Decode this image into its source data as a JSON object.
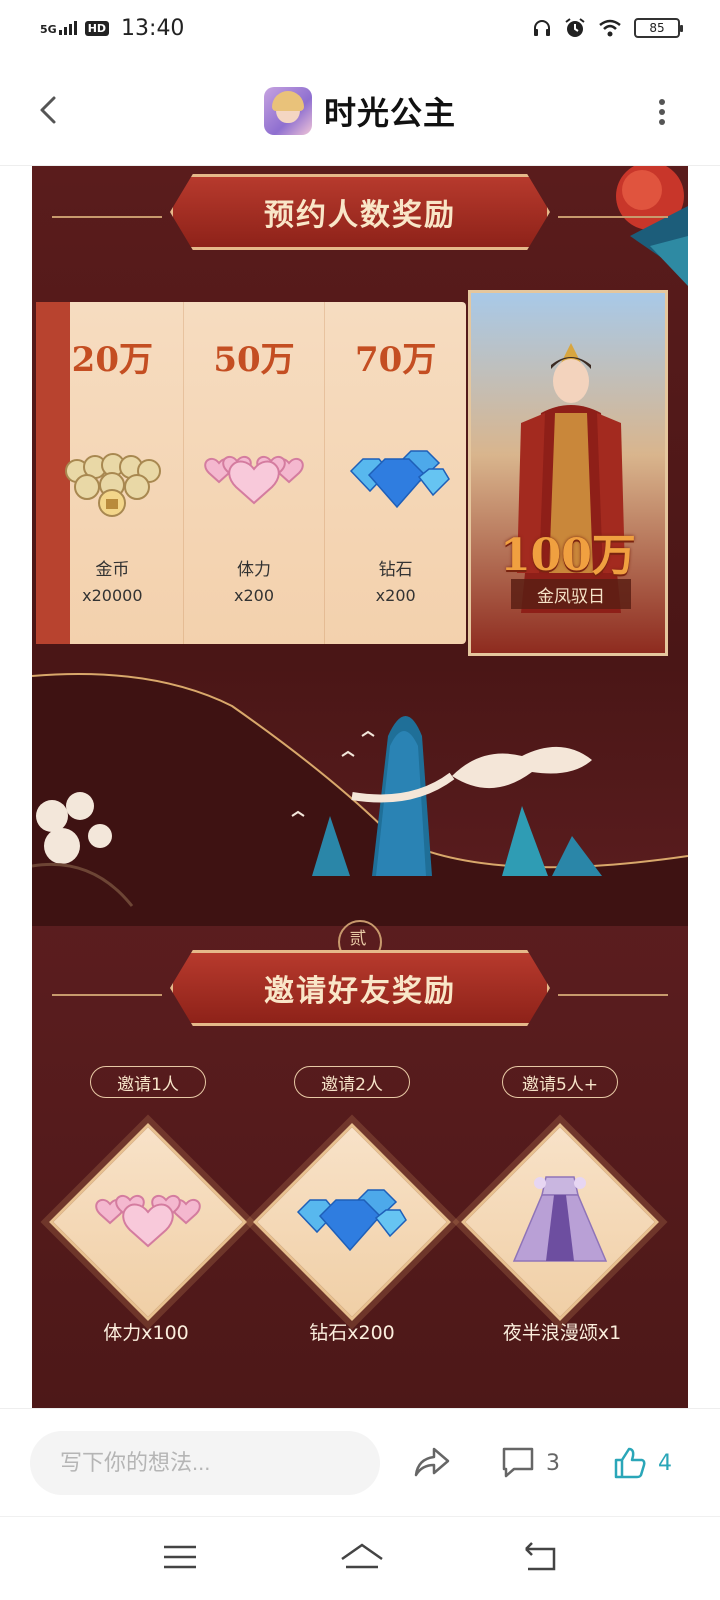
{
  "status_bar": {
    "network": "5G",
    "hd": "HD",
    "time": "13:40",
    "battery": "85",
    "icons": [
      "headphones-icon",
      "alarm-icon",
      "wifi-icon",
      "battery-icon"
    ]
  },
  "header": {
    "title": "时光公主",
    "icons": [
      "back-icon",
      "app-icon",
      "more-icon"
    ]
  },
  "poster": {
    "section1": {
      "title": "预约人数奖励",
      "tiers": [
        {
          "amount": "20万",
          "name": "金币",
          "qty": "x20000",
          "icon": "coins-icon"
        },
        {
          "amount": "50万",
          "name": "体力",
          "qty": "x200",
          "icon": "hearts-icon"
        },
        {
          "amount": "70万",
          "name": "钻石",
          "qty": "x200",
          "icon": "diamonds-icon"
        }
      ],
      "grand": {
        "amount": "100万",
        "name": "金凤驭日"
      }
    },
    "section2": {
      "mark": "贰",
      "title": "邀请好友奖励",
      "rewards": [
        {
          "condition": "邀请1人",
          "caption": "体力x100",
          "icon": "hearts-icon"
        },
        {
          "condition": "邀请2人",
          "caption": "钻石x200",
          "icon": "diamonds-icon"
        },
        {
          "condition": "邀请5人+",
          "caption": "夜半浪漫颂x1",
          "icon": "dress-icon"
        }
      ]
    }
  },
  "action_bar": {
    "placeholder": "写下你的想法...",
    "comment_count": "3",
    "like_count": "4",
    "accent": "#2aa6b8"
  },
  "nav_bar": {
    "icons": [
      "menu-icon",
      "home-icon",
      "back-nav-icon"
    ]
  }
}
